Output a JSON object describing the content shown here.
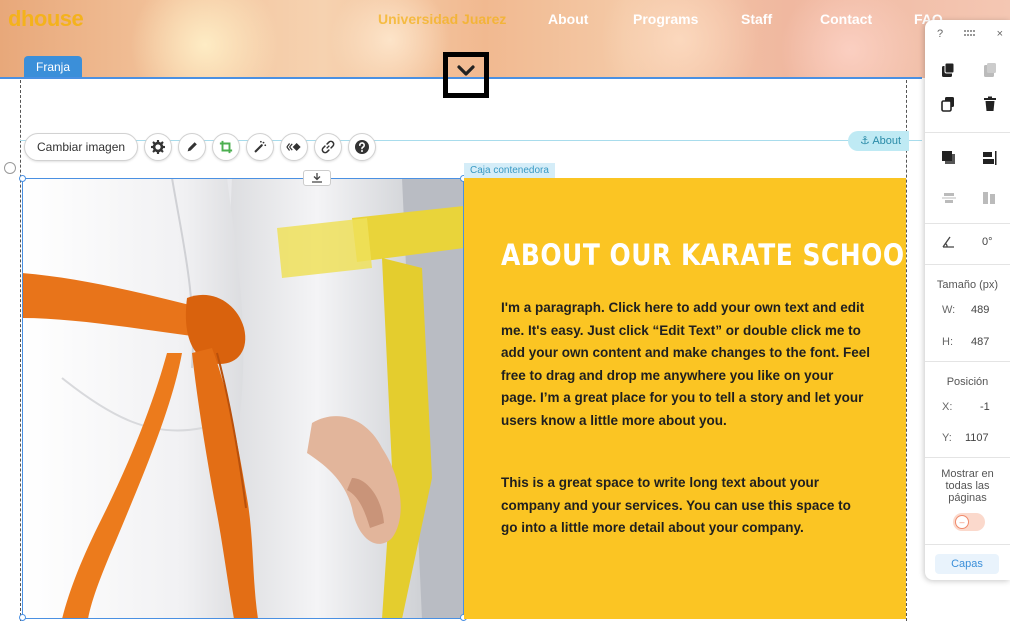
{
  "header": {
    "logo": "dhouse",
    "nav": [
      {
        "label": "Universidad Juarez",
        "active": true
      },
      {
        "label": "About",
        "active": false
      },
      {
        "label": "Programs",
        "active": false
      },
      {
        "label": "Staff",
        "active": false
      },
      {
        "label": "Contact",
        "active": false
      },
      {
        "label": "FAQ",
        "active": false
      }
    ]
  },
  "strip": {
    "tab_label": "Franja"
  },
  "collapse_icon": "chevron-down-icon",
  "image_toolbar": {
    "change_image_label": "Cambiar imagen",
    "tools": [
      "gear-icon",
      "pen-icon",
      "crop-icon",
      "magic-wand-icon",
      "animation-icon",
      "link-icon",
      "help-icon"
    ]
  },
  "anchor_badge": {
    "label": "About"
  },
  "container_label": "Caja contenedora",
  "section": {
    "title": "ABOUT OUR KARATE SCHOOL",
    "paragraph1": "I'm a paragraph. Click here to add your own text and edit me. It's easy. Just click “Edit Text” or double click me to add your own content and make changes to the font. Feel free to drag and drop me anywhere you like on your page. I’m a great place for you to tell a story and let your users know a little more about you.",
    "paragraph2": "This is a great space to write long text about your company and your services. You can use this space to go into a little more detail about your company."
  },
  "panel": {
    "help_label": "?",
    "close_label": "×",
    "rotation_value": "0°",
    "size_label": "Tamaño (px)",
    "width_label": "W:",
    "width_value": "489",
    "height_label": "H:",
    "height_value": "487",
    "position_label": "Posición",
    "x_label": "X:",
    "x_value": "-1",
    "y_label": "Y:",
    "y_value": "1107",
    "show_all_pages_label": "Mostrar en todas las páginas",
    "toggle_symbol": "–",
    "layers_label": "Capas"
  },
  "colors": {
    "accent_blue": "#3b8fd9",
    "section_yellow": "#fbc523",
    "logo_yellow": "#f4b21c"
  }
}
